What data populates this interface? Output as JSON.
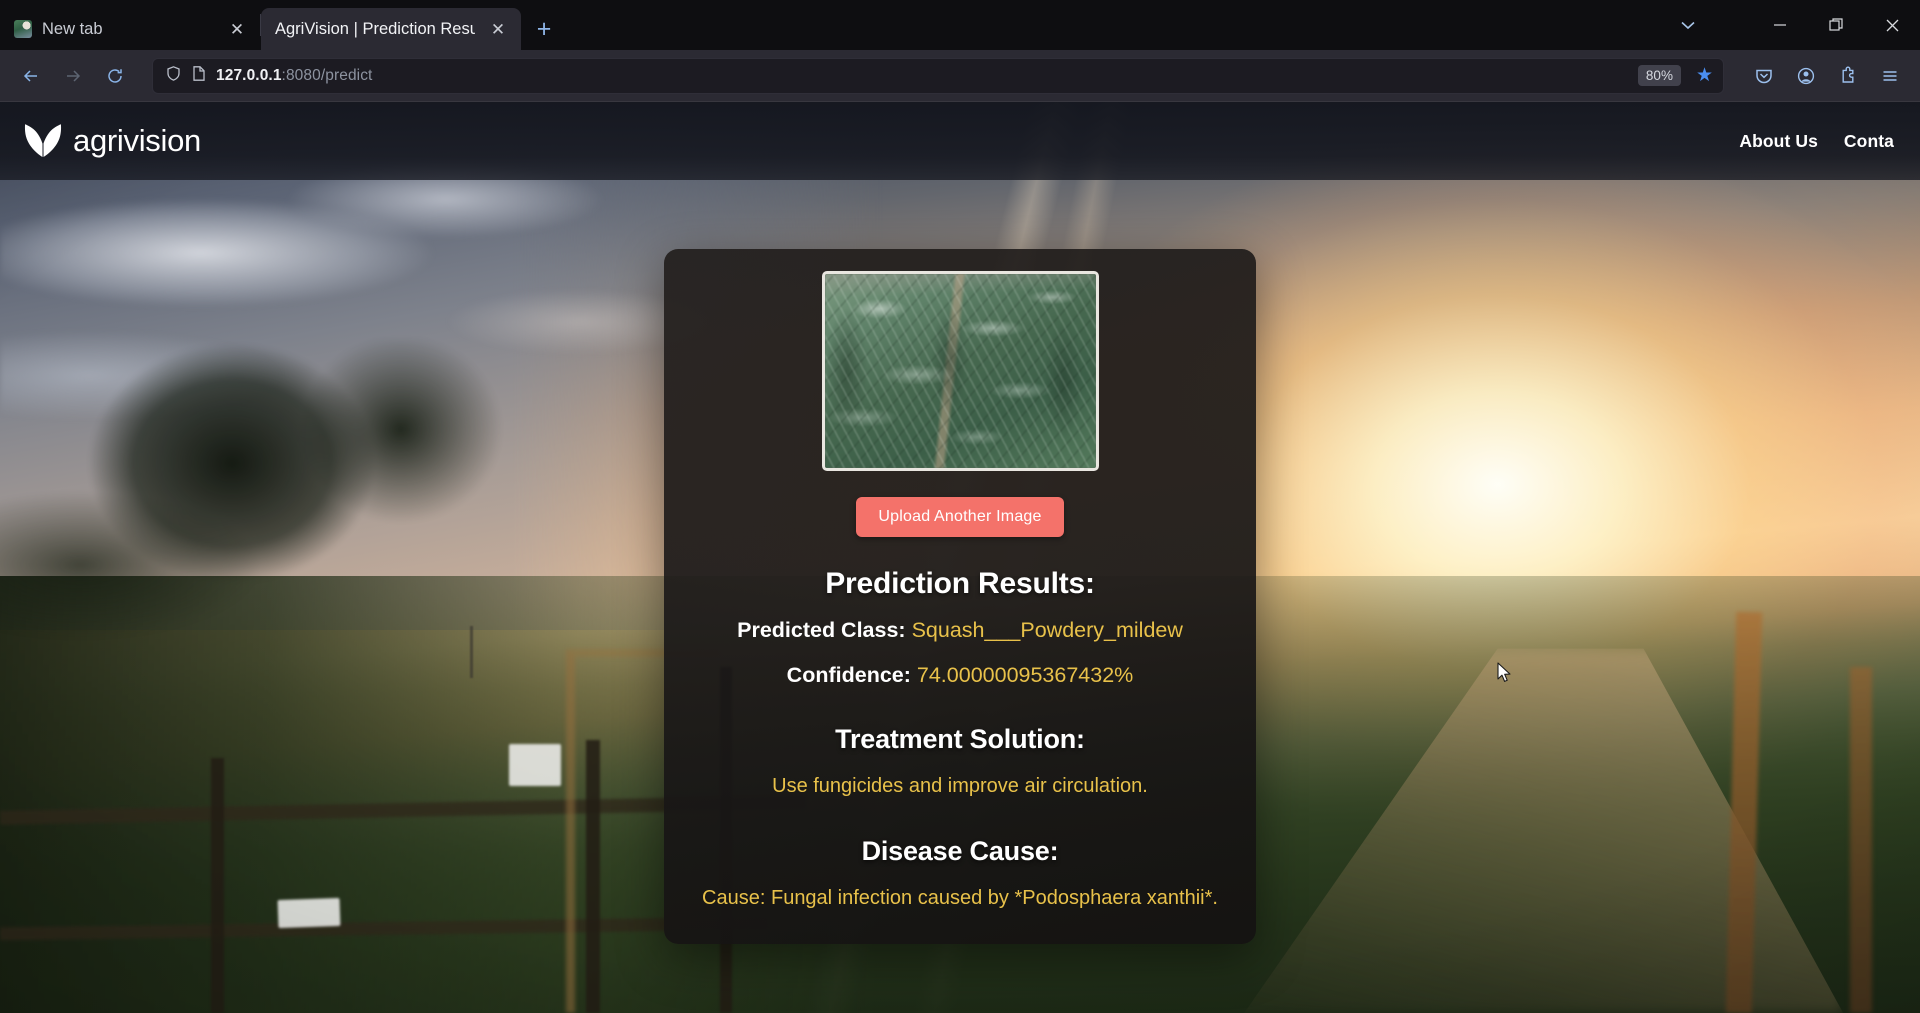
{
  "browser": {
    "tabs": [
      {
        "title": "New tab",
        "active": false,
        "favicon": "landscape-favicon",
        "close_label": "✕"
      },
      {
        "title": "AgriVision | Prediction Result",
        "active": true,
        "favicon": "none",
        "close_label": "✕"
      }
    ],
    "new_tab_label": "+",
    "window_controls": {
      "tab_list_chevron": "⌄",
      "minimize": "—",
      "maximize": "❐",
      "close": "✕"
    },
    "nav": {
      "back": "←",
      "forward": "→",
      "reload": "⟳"
    },
    "url": {
      "host": "127.0.0.1",
      "rest": ":8080/predict",
      "shield_icon": "shield-icon",
      "page_icon": "document-icon"
    },
    "zoom_level": "80%",
    "bookmark_star": "★",
    "toolbar_icons": [
      "pocket-icon",
      "account-icon",
      "extensions-icon",
      "app-menu-icon"
    ]
  },
  "site": {
    "logo_text": "agrivision",
    "nav_links": [
      "About Us",
      "Conta"
    ]
  },
  "card": {
    "thumbnail_alt": "uploaded-leaf-photo",
    "upload_button": "Upload Another Image",
    "results_heading": "Prediction Results:",
    "predicted_class_label": "Predicted Class:",
    "predicted_class_value": "Squash___Powdery_mildew",
    "confidence_label": "Confidence:",
    "confidence_value": "74.00000095367432%",
    "treatment_heading": "Treatment Solution:",
    "treatment_text": "Use fungicides and improve air circulation.",
    "cause_heading": "Disease Cause:",
    "cause_text": "Cause: Fungal infection caused by *Podosphaera xanthii*."
  },
  "colors": {
    "accent_button": "#f4726a",
    "value_text": "#e8c14a",
    "browser_chrome": "#2b2a33",
    "tabstrip": "#0e0e11"
  }
}
